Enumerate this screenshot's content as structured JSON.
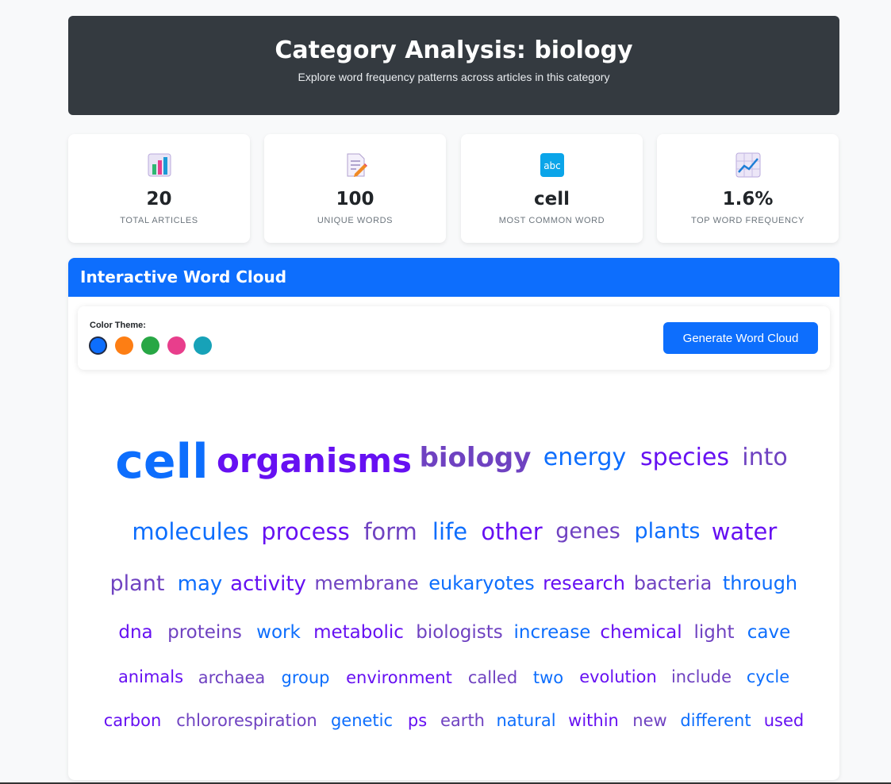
{
  "header": {
    "title": "Category Analysis: biology",
    "subtitle": "Explore word frequency patterns across articles in this category"
  },
  "stats": [
    {
      "icon": "bar-chart-icon",
      "value": "20",
      "label": "Total Articles"
    },
    {
      "icon": "memo-icon",
      "value": "100",
      "label": "Unique Words"
    },
    {
      "icon": "abc-icon",
      "value": "cell",
      "label": "Most Common Word"
    },
    {
      "icon": "trend-chart-icon",
      "value": "1.6%",
      "label": "Top Word Frequency"
    }
  ],
  "wordcloud": {
    "title": "Interactive Word Cloud",
    "color_theme_label": "Color Theme:",
    "themes": [
      "#0d6efd",
      "#fd7e14",
      "#28a745",
      "#e83e8c",
      "#17a2b8"
    ],
    "active_theme": 0,
    "generate_label": "Generate Word Cloud",
    "colors": {
      "blue": "#0d6efd",
      "purple": "#6610f2",
      "violet": "#6f42c1"
    },
    "words": [
      "cell",
      "organisms",
      "biology",
      "energy",
      "species",
      "into",
      "molecules",
      "process",
      "form",
      "life",
      "other",
      "genes",
      "plants",
      "water",
      "plant",
      "may",
      "activity",
      "membrane",
      "eukaryotes",
      "research",
      "bacteria",
      "through",
      "dna",
      "proteins",
      "work",
      "metabolic",
      "biologists",
      "increase",
      "chemical",
      "light",
      "cave",
      "animals",
      "archaea",
      "group",
      "environment",
      "called",
      "two",
      "evolution",
      "include",
      "cycle",
      "carbon",
      "chlororespiration",
      "genetic",
      "ps",
      "earth",
      "natural",
      "within",
      "new",
      "different",
      "used"
    ]
  }
}
